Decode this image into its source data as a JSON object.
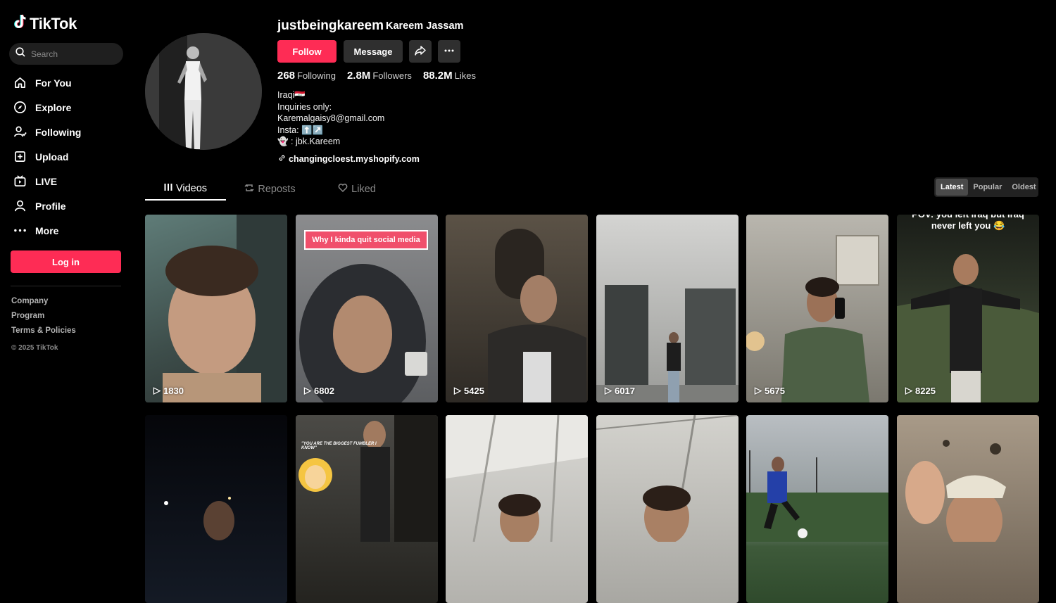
{
  "sidebar": {
    "logo_text": "TikTok",
    "search_placeholder": "Search",
    "nav": [
      {
        "label": "For You",
        "icon": "home-icon"
      },
      {
        "label": "Explore",
        "icon": "compass-icon"
      },
      {
        "label": "Following",
        "icon": "following-icon"
      },
      {
        "label": "Upload",
        "icon": "upload-icon"
      },
      {
        "label": "LIVE",
        "icon": "live-icon"
      },
      {
        "label": "Profile",
        "icon": "profile-icon"
      },
      {
        "label": "More",
        "icon": "more-icon"
      }
    ],
    "login_label": "Log in",
    "footer": {
      "company": "Company",
      "program": "Program",
      "terms": "Terms & Policies",
      "copyright": "© 2025 TikTok"
    }
  },
  "profile": {
    "username": "justbeingkareem",
    "nickname": "Kareem Jassam",
    "follow_label": "Follow",
    "message_label": "Message",
    "stats": {
      "following_count": "268",
      "following_label": "Following",
      "followers_count": "2.8M",
      "followers_label": "Followers",
      "likes_count": "88.2M",
      "likes_label": "Likes"
    },
    "bio": {
      "line1": "Iraqi🇮🇶",
      "line2": "Inquiries only:",
      "line3": "Karemalgaisy8@gmail.com",
      "line4": "Insta: ⬆️↗️",
      "line5": "👻 : jbk.Kareem"
    },
    "link": "changingcloest.myshopify.com"
  },
  "tabs": [
    {
      "label": "Videos"
    },
    {
      "label": "Reposts"
    },
    {
      "label": "Liked"
    }
  ],
  "sort": [
    "Latest",
    "Popular",
    "Oldest"
  ],
  "videos": [
    {
      "views": "1830",
      "bg": "#4f6563",
      "caption": ""
    },
    {
      "views": "6802",
      "bg": "#6f7376",
      "caption": "Why I kinda quit social media"
    },
    {
      "views": "5425",
      "bg": "#3e3a33",
      "caption": ""
    },
    {
      "views": "6017",
      "bg": "#a9aaa8",
      "caption": ""
    },
    {
      "views": "5675",
      "bg": "#9c9890",
      "caption": ""
    },
    {
      "views": "8225",
      "bg": "#262a22",
      "caption": "POV: you left Iraq but Iraq never left you 😂"
    },
    {
      "views": "",
      "bg": "#0c0e14",
      "caption": ""
    },
    {
      "views": "",
      "bg": "#3b3732",
      "caption": "\"YOU ARE THE BIGGEST FUMBLER I KNOW\""
    },
    {
      "views": "",
      "bg": "#c9c9c5",
      "caption": ""
    },
    {
      "views": "",
      "bg": "#bdbdb8",
      "caption": ""
    },
    {
      "views": "",
      "bg": "#7f8a8a",
      "caption": ""
    },
    {
      "views": "",
      "bg": "#8e7f6e",
      "caption": ""
    }
  ]
}
